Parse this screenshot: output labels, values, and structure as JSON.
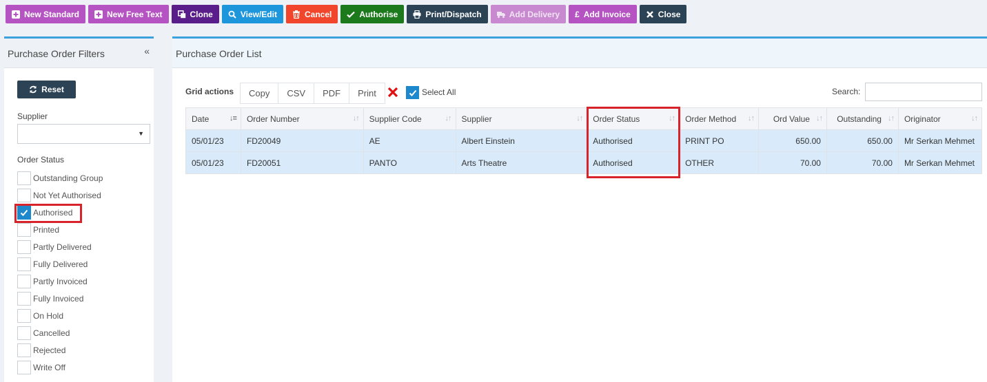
{
  "toolbar": [
    {
      "label": "New Standard",
      "icon": "plus-square-icon",
      "color": "#b553c2"
    },
    {
      "label": "New Free Text",
      "icon": "plus-square-icon",
      "color": "#b553c2"
    },
    {
      "label": "Clone",
      "icon": "clone-icon",
      "color": "#5a1e8a"
    },
    {
      "label": "View/Edit",
      "icon": "search-icon",
      "color": "#1e96dc"
    },
    {
      "label": "Cancel",
      "icon": "trash-icon",
      "color": "#f1462b"
    },
    {
      "label": "Authorise",
      "icon": "check-icon",
      "color": "#1c7a1c"
    },
    {
      "label": "Print/Dispatch",
      "icon": "printer-icon",
      "color": "#2c4356"
    },
    {
      "label": "Add Delivery",
      "icon": "truck-icon",
      "color": "#c889d0",
      "disabled": true
    },
    {
      "label": "Add Invoice",
      "icon": "pound-icon",
      "color": "#b553c2"
    },
    {
      "label": "Close",
      "icon": "close-icon",
      "color": "#2c4356"
    }
  ],
  "filters": {
    "title": "Purchase Order Filters",
    "collapse_glyph": "«",
    "reset_label": "Reset",
    "supplier_label": "Supplier",
    "supplier_value": "",
    "order_status_label": "Order Status",
    "statuses": [
      {
        "label": "Outstanding Group",
        "checked": false
      },
      {
        "label": "Not Yet Authorised",
        "checked": false
      },
      {
        "label": "Authorised",
        "checked": true
      },
      {
        "label": "Printed",
        "checked": false
      },
      {
        "label": "Partly Delivered",
        "checked": false
      },
      {
        "label": "Fully Delivered",
        "checked": false
      },
      {
        "label": "Partly Invoiced",
        "checked": false
      },
      {
        "label": "Fully Invoiced",
        "checked": false
      },
      {
        "label": "On Hold",
        "checked": false
      },
      {
        "label": "Cancelled",
        "checked": false
      },
      {
        "label": "Rejected",
        "checked": false
      },
      {
        "label": "Write Off",
        "checked": false
      }
    ]
  },
  "list": {
    "title": "Purchase Order List",
    "grid_actions_label": "Grid actions",
    "grid_actions": [
      "Copy",
      "CSV",
      "PDF",
      "Print"
    ],
    "select_all_label": "Select All",
    "search_label": "Search:",
    "search_value": "",
    "columns": [
      "Date",
      "Order Number",
      "Supplier Code",
      "Supplier",
      "Order Status",
      "Order Method",
      "Ord Value",
      "Outstanding",
      "Originator"
    ],
    "rows": [
      [
        "05/01/23",
        "FD20049",
        "AE",
        "Albert Einstein",
        "Authorised",
        "PRINT PO",
        "650.00",
        "650.00",
        "Mr Serkan Mehmet"
      ],
      [
        "05/01/23",
        "FD20051",
        "PANTO",
        "Arts Theatre",
        "Authorised",
        "OTHER",
        "70.00",
        "70.00",
        "Mr Serkan Mehmet"
      ]
    ]
  },
  "colors": {
    "accent": "#3ba0dc",
    "highlight": "#d8232a",
    "row_selected": "#d9ebfa"
  }
}
